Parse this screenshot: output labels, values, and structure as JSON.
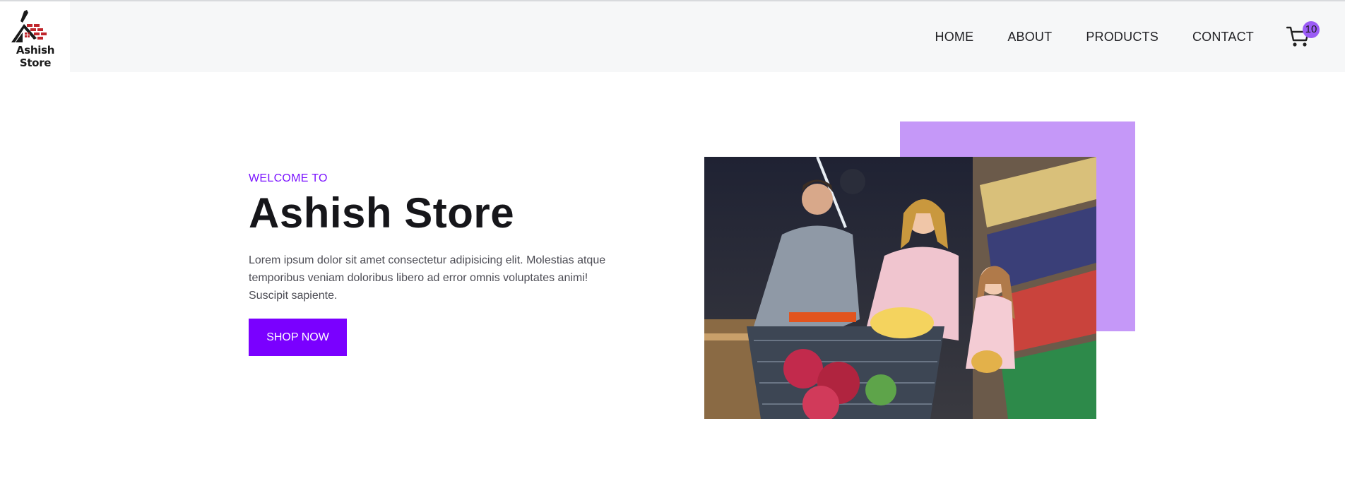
{
  "brand": {
    "name": "Ashish Store"
  },
  "nav": {
    "items": [
      {
        "label": "HOME"
      },
      {
        "label": "ABOUT"
      },
      {
        "label": "PRODUCTS"
      },
      {
        "label": "CONTACT"
      }
    ],
    "cart_count": "10"
  },
  "hero": {
    "eyebrow": "WELCOME TO",
    "title": "Ashish Store",
    "description": "Lorem ipsum dolor sit amet consectetur adipisicing elit. Molestias atque temporibus veniam doloribus libero ad error omnis voluptates animi! Suscipit sapiente.",
    "cta_label": "SHOP NOW"
  },
  "colors": {
    "accent": "#7a00ff",
    "accent_light": "#c598f8",
    "badge": "#9b5cf6",
    "nav_bg": "#f6f7f8"
  },
  "icons": [
    "house-logo-icon",
    "cart-icon"
  ]
}
